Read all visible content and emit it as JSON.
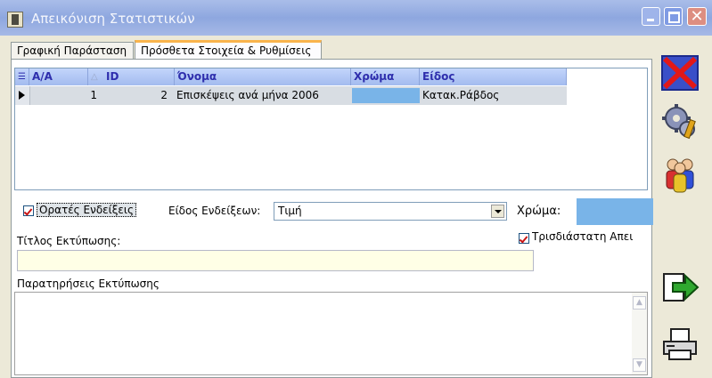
{
  "window": {
    "title": "Απεικόνιση Στατιστικών"
  },
  "tabs": [
    {
      "label": "Γραφική Παράσταση"
    },
    {
      "label": "Πρόσθετα Στοιχεία & Ρυθμίσεις"
    }
  ],
  "grid": {
    "headers": {
      "aa": "A/A",
      "id": "ID",
      "name": "Όνομα",
      "color": "Χρώμα",
      "type": "Είδος"
    },
    "rows": [
      {
        "aa": "1",
        "id": "2",
        "name": "Επισκέψεις ανά μήνα 2006",
        "color": "#79b4e8",
        "type": "Κατακ.Ράβδος"
      }
    ]
  },
  "options": {
    "visible_labels": "Ορατές Ενδείξεις",
    "label_type_caption": "Είδος Ενδείξεων:",
    "label_type_value": "Τιμή",
    "color_caption": "Χρώμα:",
    "color_value": "#79b4e8",
    "three_d": "Τρισδιάστατη Απει",
    "print_title_caption": "Τίτλος Εκτύπωσης:",
    "print_title_value": "",
    "notes_caption": "Παρατηρήσεις Εκτύπωσης",
    "notes_value": ""
  },
  "sidebar": {
    "icons": [
      "delete-icon",
      "settings-gears-icon",
      "users-icon",
      "exit-arrow-icon",
      "print-icon"
    ]
  }
}
